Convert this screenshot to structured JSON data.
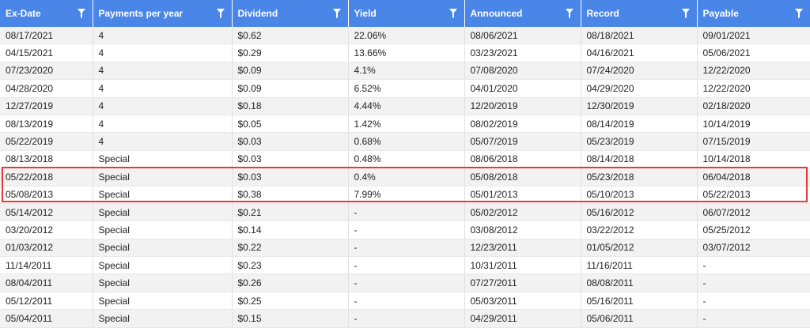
{
  "columns": [
    "Ex-Date",
    "Payments per year",
    "Dividend",
    "Yield",
    "Announced",
    "Record",
    "Payable"
  ],
  "icons": {
    "filter": "filter-funnel-icon"
  },
  "colors": {
    "header_bg": "#4a86e8",
    "highlight_border": "#e53935"
  },
  "rows": [
    [
      "08/17/2021",
      "4",
      "$0.62",
      "22.06%",
      "08/06/2021",
      "08/18/2021",
      "09/01/2021"
    ],
    [
      "04/15/2021",
      "4",
      "$0.29",
      "13.66%",
      "03/23/2021",
      "04/16/2021",
      "05/06/2021"
    ],
    [
      "07/23/2020",
      "4",
      "$0.09",
      "4.1%",
      "07/08/2020",
      "07/24/2020",
      "12/22/2020"
    ],
    [
      "04/28/2020",
      "4",
      "$0.09",
      "6.52%",
      "04/01/2020",
      "04/29/2020",
      "12/22/2020"
    ],
    [
      "12/27/2019",
      "4",
      "$0.18",
      "4.44%",
      "12/20/2019",
      "12/30/2019",
      "02/18/2020"
    ],
    [
      "08/13/2019",
      "4",
      "$0.05",
      "1.42%",
      "08/02/2019",
      "08/14/2019",
      "10/14/2019"
    ],
    [
      "05/22/2019",
      "4",
      "$0.03",
      "0.68%",
      "05/07/2019",
      "05/23/2019",
      "07/15/2019"
    ],
    [
      "08/13/2018",
      "Special",
      "$0.03",
      "0.48%",
      "08/06/2018",
      "08/14/2018",
      "10/14/2018"
    ],
    [
      "05/22/2018",
      "Special",
      "$0.03",
      "0.4%",
      "05/08/2018",
      "05/23/2018",
      "06/04/2018"
    ],
    [
      "05/08/2013",
      "Special",
      "$0.38",
      "7.99%",
      "05/01/2013",
      "05/10/2013",
      "05/22/2013"
    ],
    [
      "05/14/2012",
      "Special",
      "$0.21",
      "-",
      "05/02/2012",
      "05/16/2012",
      "06/07/2012"
    ],
    [
      "03/20/2012",
      "Special",
      "$0.14",
      "-",
      "03/08/2012",
      "03/22/2012",
      "05/25/2012"
    ],
    [
      "01/03/2012",
      "Special",
      "$0.22",
      "-",
      "12/23/2011",
      "01/05/2012",
      "03/07/2012"
    ],
    [
      "11/14/2011",
      "Special",
      "$0.23",
      "-",
      "10/31/2011",
      "11/16/2011",
      "-"
    ],
    [
      "08/04/2011",
      "Special",
      "$0.26",
      "-",
      "07/27/2011",
      "08/08/2011",
      "-"
    ],
    [
      "05/12/2011",
      "Special",
      "$0.25",
      "-",
      "05/03/2011",
      "05/16/2011",
      "-"
    ],
    [
      "05/04/2011",
      "Special",
      "$0.15",
      "-",
      "04/29/2011",
      "05/06/2011",
      "-"
    ]
  ]
}
